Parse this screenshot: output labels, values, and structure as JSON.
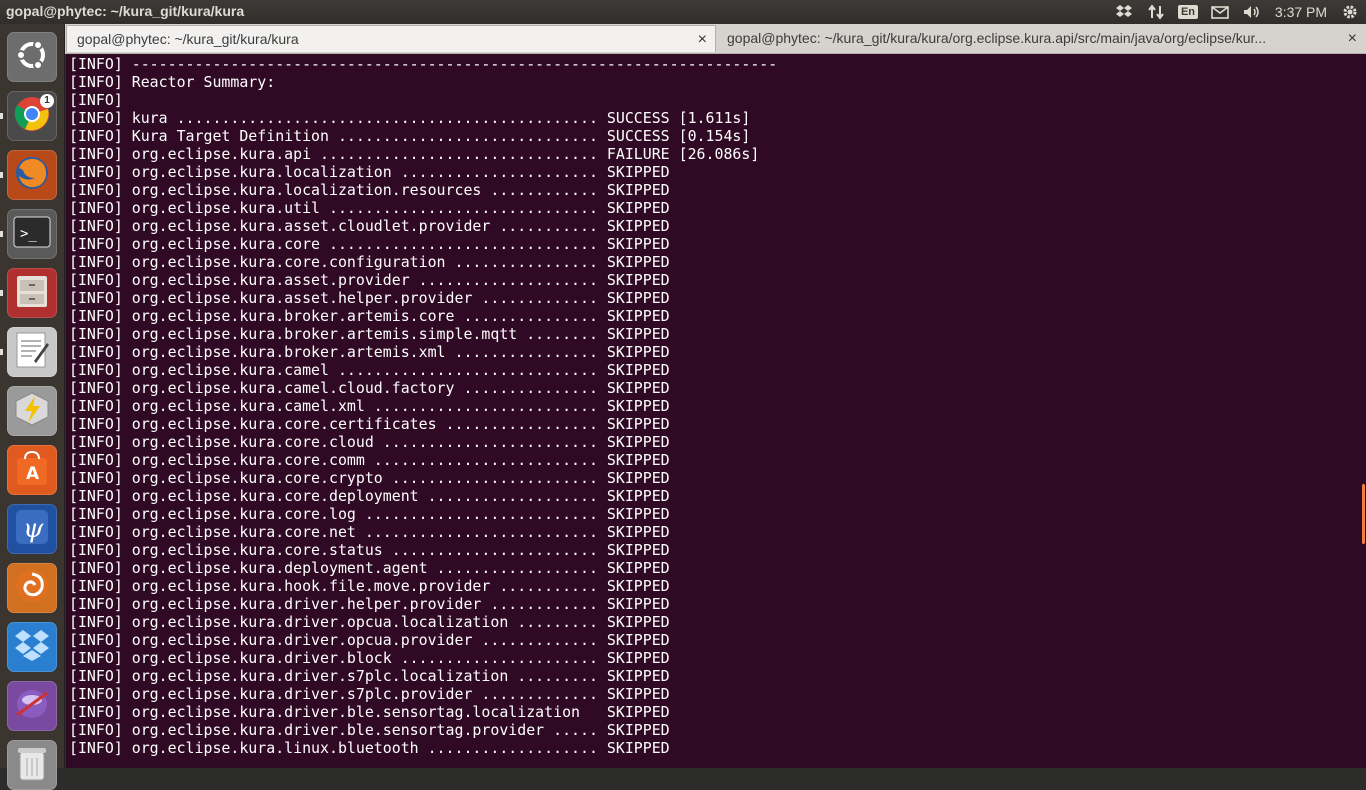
{
  "top_panel": {
    "window_title": "gopal@phytec: ~/kura_git/kura/kura",
    "keyboard_layout": "En",
    "time": "3:37 PM"
  },
  "launcher": {
    "items": [
      {
        "name": "ubuntu-dash",
        "icon": "ubuntu-logo-icon",
        "color": "#6d6d6d"
      },
      {
        "name": "chrome",
        "icon": "chrome-icon",
        "color": "#4a4a4a",
        "badge": "1"
      },
      {
        "name": "firefox",
        "icon": "firefox-icon",
        "color": "#b84a1a"
      },
      {
        "name": "terminal",
        "icon": "terminal-icon",
        "color": "#5a5a5a"
      },
      {
        "name": "files",
        "icon": "file-cabinet-icon",
        "color": "#b03030"
      },
      {
        "name": "text-editor",
        "icon": "text-editor-icon",
        "color": "#c8c8c8"
      },
      {
        "name": "cube-app",
        "icon": "lightning-cube-icon",
        "color": "#9a9a9a"
      },
      {
        "name": "software-center",
        "icon": "software-center-icon",
        "color": "#e05a20"
      },
      {
        "name": "psi-app",
        "icon": "psi-icon",
        "color": "#2050a0"
      },
      {
        "name": "swirl-app",
        "icon": "swirl-icon",
        "color": "#d07020"
      },
      {
        "name": "dropbox",
        "icon": "dropbox-icon",
        "color": "#2a7fd0"
      },
      {
        "name": "sphere-app",
        "icon": "sphere-icon",
        "color": "#7a4aa0"
      },
      {
        "name": "trash",
        "icon": "trash-icon",
        "color": "#8a8a8a"
      }
    ]
  },
  "tabs": [
    {
      "label": "gopal@phytec: ~/kura_git/kura/kura",
      "close": "×"
    },
    {
      "label": "gopal@phytec: ~/kura_git/kura/kura/org.eclipse.kura.api/src/main/java/org/eclipse/kur...",
      "close": "×"
    }
  ],
  "terminal": {
    "lines": [
      "[INFO] ------------------------------------------------------------------------",
      "[INFO] Reactor Summary:",
      "[INFO]",
      "[INFO] kura ............................................... SUCCESS [1.611s]",
      "[INFO] Kura Target Definition ............................. SUCCESS [0.154s]",
      "[INFO] org.eclipse.kura.api ............................... FAILURE [26.086s]",
      "[INFO] org.eclipse.kura.localization ...................... SKIPPED",
      "[INFO] org.eclipse.kura.localization.resources ............ SKIPPED",
      "[INFO] org.eclipse.kura.util .............................. SKIPPED",
      "[INFO] org.eclipse.kura.asset.cloudlet.provider ........... SKIPPED",
      "[INFO] org.eclipse.kura.core .............................. SKIPPED",
      "[INFO] org.eclipse.kura.core.configuration ................ SKIPPED",
      "[INFO] org.eclipse.kura.asset.provider .................... SKIPPED",
      "[INFO] org.eclipse.kura.asset.helper.provider ............. SKIPPED",
      "[INFO] org.eclipse.kura.broker.artemis.core ............... SKIPPED",
      "[INFO] org.eclipse.kura.broker.artemis.simple.mqtt ........ SKIPPED",
      "[INFO] org.eclipse.kura.broker.artemis.xml ................ SKIPPED",
      "[INFO] org.eclipse.kura.camel ............................. SKIPPED",
      "[INFO] org.eclipse.kura.camel.cloud.factory ............... SKIPPED",
      "[INFO] org.eclipse.kura.camel.xml ......................... SKIPPED",
      "[INFO] org.eclipse.kura.core.certificates ................. SKIPPED",
      "[INFO] org.eclipse.kura.core.cloud ........................ SKIPPED",
      "[INFO] org.eclipse.kura.core.comm ......................... SKIPPED",
      "[INFO] org.eclipse.kura.core.crypto ....................... SKIPPED",
      "[INFO] org.eclipse.kura.core.deployment ................... SKIPPED",
      "[INFO] org.eclipse.kura.core.log .......................... SKIPPED",
      "[INFO] org.eclipse.kura.core.net .......................... SKIPPED",
      "[INFO] org.eclipse.kura.core.status ....................... SKIPPED",
      "[INFO] org.eclipse.kura.deployment.agent .................. SKIPPED",
      "[INFO] org.eclipse.kura.hook.file.move.provider ........... SKIPPED",
      "[INFO] org.eclipse.kura.driver.helper.provider ............ SKIPPED",
      "[INFO] org.eclipse.kura.driver.opcua.localization ......... SKIPPED",
      "[INFO] org.eclipse.kura.driver.opcua.provider ............. SKIPPED",
      "[INFO] org.eclipse.kura.driver.block ...................... SKIPPED",
      "[INFO] org.eclipse.kura.driver.s7plc.localization ......... SKIPPED",
      "[INFO] org.eclipse.kura.driver.s7plc.provider ............. SKIPPED",
      "[INFO] org.eclipse.kura.driver.ble.sensortag.localization   SKIPPED",
      "[INFO] org.eclipse.kura.driver.ble.sensortag.provider ..... SKIPPED",
      "[INFO] org.eclipse.kura.linux.bluetooth ................... SKIPPED"
    ]
  }
}
